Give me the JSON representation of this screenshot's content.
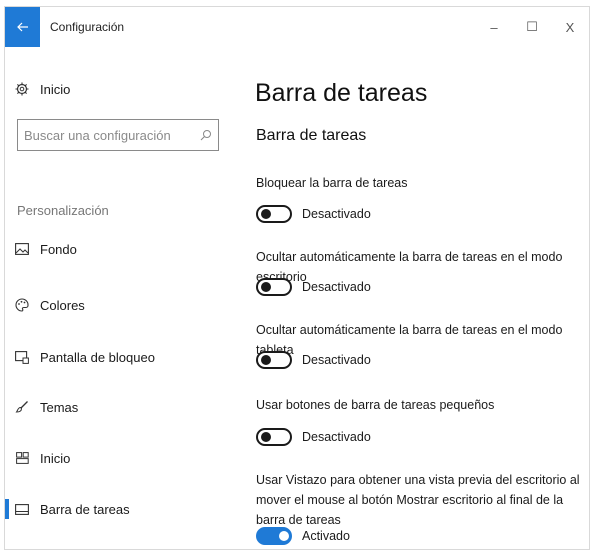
{
  "window": {
    "title": "Configuración",
    "back_icon": "arrow-left-icon",
    "controls": {
      "minimize": "–",
      "maximize": "☐",
      "close": "X"
    }
  },
  "sidebar": {
    "home_label": "Inicio",
    "search_placeholder": "Buscar una configuración",
    "section_label": "Personalización",
    "items": [
      {
        "label": "Fondo",
        "icon": "image-icon"
      },
      {
        "label": "Colores",
        "icon": "palette-icon"
      },
      {
        "label": "Pantalla de bloqueo",
        "icon": "lock-screen-icon"
      },
      {
        "label": "Temas",
        "icon": "brush-icon"
      },
      {
        "label": "Inicio",
        "icon": "start-icon"
      },
      {
        "label": "Barra de tareas",
        "icon": "taskbar-icon",
        "active": true
      }
    ]
  },
  "main": {
    "title": "Barra de tareas",
    "subtitle": "Barra de tareas",
    "settings": [
      {
        "label": "Bloquear la barra de tareas",
        "state": "Desactivado",
        "on": false
      },
      {
        "label": "Ocultar automáticamente la barra de tareas en el modo escritorio",
        "state": "Desactivado",
        "on": false
      },
      {
        "label": "Ocultar automáticamente la barra de tareas en el modo tableta",
        "state": "Desactivado",
        "on": false
      },
      {
        "label": "Usar botones de barra de tareas pequeños",
        "state": "Desactivado",
        "on": false
      },
      {
        "label": "Usar Vistazo para obtener una vista previa del escritorio al mover el mouse al botón Mostrar escritorio al final de la barra de tareas",
        "state": "Activado",
        "on": true
      }
    ]
  },
  "colors": {
    "accent": "#1f7ad6"
  }
}
